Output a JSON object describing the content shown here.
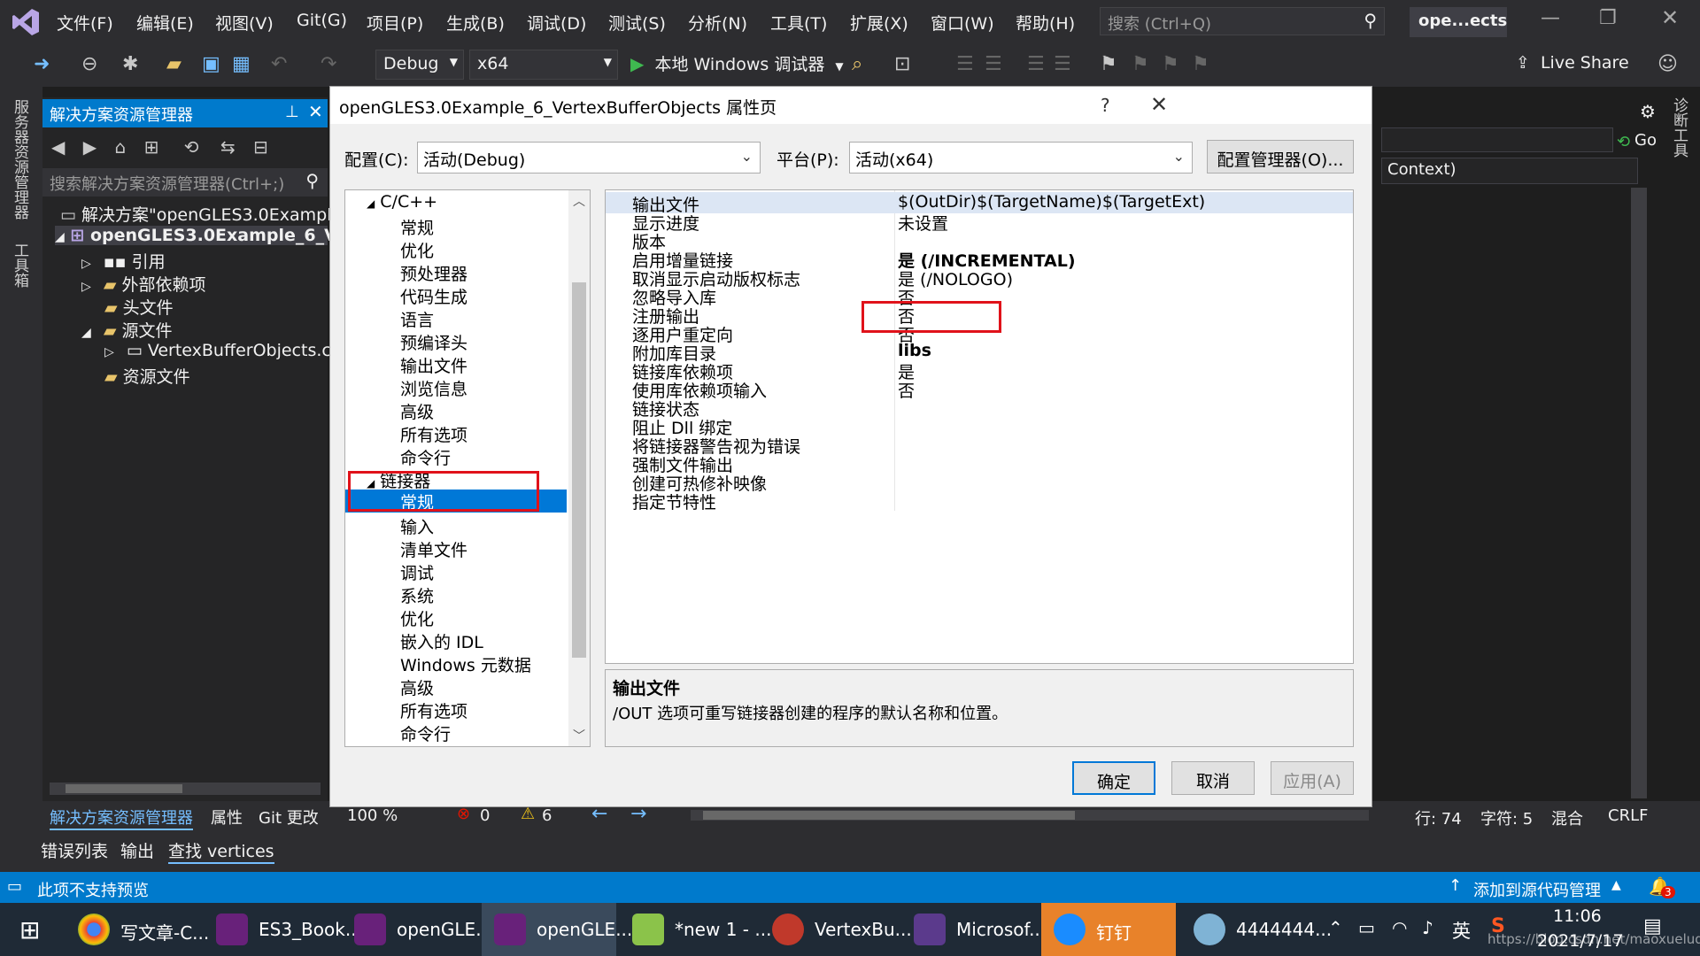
{
  "menubar": {
    "items": [
      "文件(F)",
      "编辑(E)",
      "视图(V)",
      "Git(G)",
      "项目(P)",
      "生成(B)",
      "调试(D)",
      "测试(S)",
      "分析(N)",
      "工具(T)",
      "扩展(X)",
      "窗口(W)",
      "帮助(H)"
    ],
    "search_placeholder": "搜索 (Ctrl+Q)",
    "project_badge": "ope...ects"
  },
  "toolbar": {
    "config": "Debug",
    "platform": "x64",
    "run_label": "本地 Windows 调试器",
    "live_share": "Live Share"
  },
  "side_strip": {
    "server_explorer": "服务器资源管理器",
    "toolbox": "工具箱",
    "diagnostics": "诊断工具"
  },
  "solution_explorer": {
    "title": "解决方案资源管理器",
    "search_placeholder": "搜索解决方案资源管理器(Ctrl+;)",
    "solution": "解决方案\"openGLES3.0Example",
    "project": "openGLES3.0Example_6_Ve",
    "references": "引用",
    "external_deps": "外部依赖项",
    "headers": "头文件",
    "sources": "源文件",
    "source_file": "VertexBufferObjects.c",
    "resources": "资源文件"
  },
  "dialog": {
    "title": "openGLES3.0Example_6_VertexBufferObjects 属性页",
    "help": "?",
    "config_label": "配置(C):",
    "config_value": "活动(Debug)",
    "platform_label": "平台(P):",
    "platform_value": "活动(x64)",
    "config_manager": "配置管理器(O)...",
    "categories": {
      "cpp_header": "C/C++",
      "cpp_items": [
        "常规",
        "优化",
        "预处理器",
        "代码生成",
        "语言",
        "预编译头",
        "输出文件",
        "浏览信息",
        "高级",
        "所有选项",
        "命令行"
      ],
      "linker_header": "链接器",
      "linker_items": [
        "常规",
        "输入",
        "清单文件",
        "调试",
        "系统",
        "优化",
        "嵌入的 IDL",
        "Windows 元数据",
        "高级",
        "所有选项",
        "命令行"
      ]
    },
    "properties": [
      {
        "name": "输出文件",
        "value": "$(OutDir)$(TargetName)$(TargetExt)"
      },
      {
        "name": "显示进度",
        "value": "未设置"
      },
      {
        "name": "版本",
        "value": ""
      },
      {
        "name": "启用增量链接",
        "value": "是 (/INCREMENTAL)"
      },
      {
        "name": "取消显示启动版权标志",
        "value": "是 (/NOLOGO)"
      },
      {
        "name": "忽略导入库",
        "value": "否"
      },
      {
        "name": "注册输出",
        "value": "否"
      },
      {
        "name": "逐用户重定向",
        "value": "否"
      },
      {
        "name": "附加库目录",
        "value": "libs"
      },
      {
        "name": "链接库依赖项",
        "value": "是"
      },
      {
        "name": "使用库依赖项输入",
        "value": "否"
      },
      {
        "name": "链接状态",
        "value": ""
      },
      {
        "name": "阻止 Dll 绑定",
        "value": ""
      },
      {
        "name": "将链接器警告视为错误",
        "value": ""
      },
      {
        "name": "强制文件输出",
        "value": ""
      },
      {
        "name": "创建可热修补映像",
        "value": ""
      },
      {
        "name": "指定节特性",
        "value": ""
      }
    ],
    "desc_title": "输出文件",
    "desc_text": "/OUT 选项可重写链接器创建的程序的默认名称和位置。",
    "ok": "确定",
    "cancel": "取消",
    "apply": "应用(A)"
  },
  "editor": {
    "go_label": "Go",
    "context_text": "Context)"
  },
  "lower_tabs": {
    "sol": "解决方案资源管理器",
    "props": "属性",
    "git": "Git 更改",
    "zoom": "100 %",
    "errors": "0",
    "warnings": "6",
    "line": "行: 74",
    "col": "字符: 5",
    "mixed": "混合",
    "crlf": "CRLF",
    "error_list": "错误列表",
    "output": "输出",
    "find": "查找 vertices"
  },
  "statusbar": {
    "left": "此项不支持预览",
    "right": "添加到源代码管理",
    "notify": "3"
  },
  "taskbar": {
    "apps": [
      "写文章-C...",
      "ES3_Book...",
      "openGLE...",
      "openGLE...",
      "*new 1 - ...",
      "VertexBu...",
      "Microsof...",
      "钉钉",
      "4444444..."
    ],
    "ime": "英",
    "time": "11:06",
    "date": "2021/7/17",
    "watermark": "https://blog.csdn.net/maoxueludy"
  }
}
